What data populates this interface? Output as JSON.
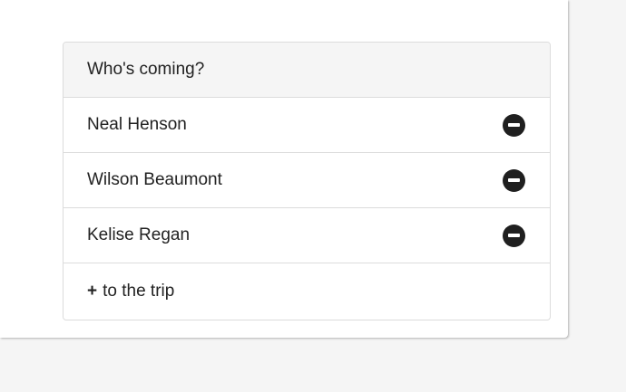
{
  "guests_panel": {
    "header": "Who's coming?",
    "guests": [
      {
        "name": "Neal Henson",
        "action_icon": "remove-circle-icon"
      },
      {
        "name": "Wilson Beaumont",
        "action_icon": "remove-circle-icon"
      },
      {
        "name": "Kelise Regan",
        "action_icon": "remove-circle-icon"
      }
    ],
    "add_plus": "+",
    "add_label": "to the trip"
  },
  "colors": {
    "background": "#f5f5f5",
    "card": "#ffffff",
    "header_bg": "#f5f5f5",
    "border": "#dcdcdc",
    "text": "#222222",
    "icon": "#1f1f1f"
  }
}
